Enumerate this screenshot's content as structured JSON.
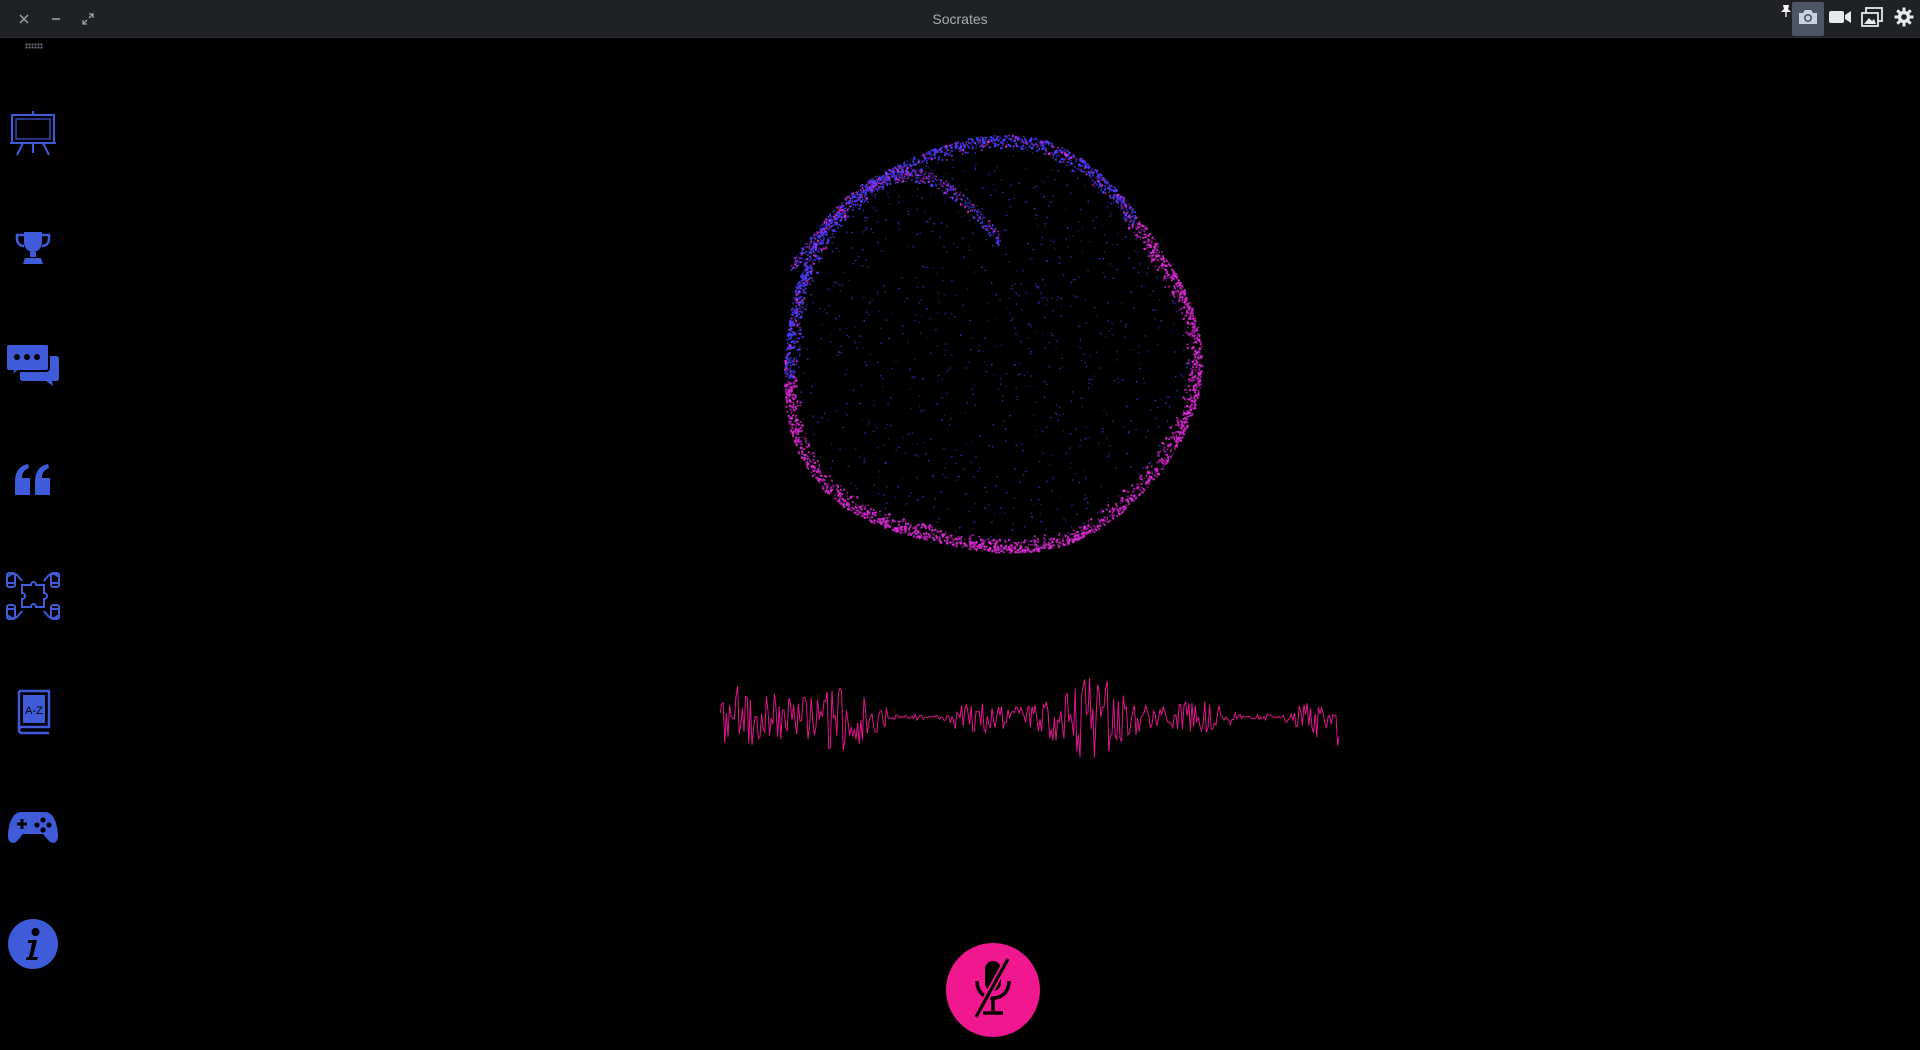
{
  "window": {
    "title": "Socrates",
    "controls": [
      {
        "name": "close-button",
        "glyph": "✕"
      },
      {
        "name": "minimize-button",
        "glyph": "−"
      },
      {
        "name": "restore-button",
        "glyph": "⤡"
      }
    ]
  },
  "toolbar": {
    "items": [
      "pin-icon",
      "camera-icon",
      "video-camera-icon",
      "gallery-icon",
      "gear-icon"
    ]
  },
  "sidebar": {
    "items": [
      {
        "name": "presentation-icon"
      },
      {
        "name": "trophy-icon"
      },
      {
        "name": "chat-icon"
      },
      {
        "name": "quote-icon"
      },
      {
        "name": "puzzle-hands-icon"
      },
      {
        "name": "dictionary-icon"
      },
      {
        "name": "gamepad-icon"
      },
      {
        "name": "info-icon"
      }
    ]
  },
  "colors": {
    "accent": "#3f5bd9",
    "orb_blue": "#4c3dff",
    "orb_magenta": "#e02ad8",
    "waveform": "#e0158c",
    "mic_button": "#f0178f",
    "background": "#000000",
    "titlebar": "#1f2124"
  },
  "mic": {
    "state": "muted",
    "icon": "microphone-slash-icon"
  }
}
